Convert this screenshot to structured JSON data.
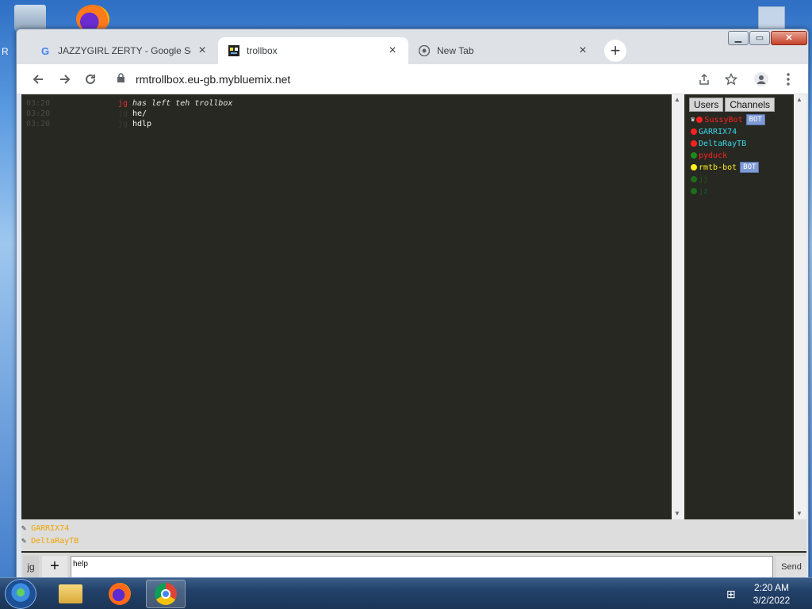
{
  "desktop": {
    "label_partial": "R"
  },
  "browser": {
    "tabs": [
      {
        "title": "JAZZYGIRL ZERTY - Google Search",
        "icon": "google-icon",
        "active": false
      },
      {
        "title": "trollbox",
        "icon": "trollbox-icon",
        "active": true
      },
      {
        "title": "New Tab",
        "icon": "chrome-icon",
        "active": false
      }
    ],
    "url": "rmtrollbox.eu-gb.mybluemix.net",
    "google_glyph": "G",
    "newtab_glyph": "+",
    "close_glyph": "×"
  },
  "chat": {
    "messages": [
      {
        "time": "03:20",
        "nick": "jg",
        "text": "has left teh trollbox",
        "system": true,
        "nick_color": "#e03030"
      },
      {
        "time": "03:20",
        "nick": "jg",
        "text": "he/",
        "system": false,
        "nick_color": "#3a3a34"
      },
      {
        "time": "03:20",
        "nick": "jg",
        "text": "hdlp",
        "system": false,
        "nick_color": "#3a3a34"
      }
    ]
  },
  "users_panel": {
    "tabs": [
      "Users",
      "Channels"
    ],
    "users": [
      {
        "name": "SussyBot",
        "dot_color": "#ff2020",
        "name_color": "#ff2020",
        "bot": true,
        "crown": true
      },
      {
        "name": "GARRIX74",
        "dot_color": "#ff2020",
        "name_color": "#3ad7e8",
        "bot": false
      },
      {
        "name": "DeltaRayTB",
        "dot_color": "#ff2020",
        "name_color": "#3ad7e8",
        "bot": false
      },
      {
        "name": "pyduck",
        "dot_color": "#1b8c1b",
        "name_color": "#ff2020",
        "bot": false
      },
      {
        "name": "rmtb-bot",
        "dot_color": "#ffee22",
        "name_color": "#ffee22",
        "bot": true
      },
      {
        "name": "jj",
        "dot_color": "#1b6e1b",
        "name_color": "#1d5a1d",
        "bot": false
      },
      {
        "name": "jz",
        "dot_color": "#1b6e1b",
        "name_color": "#1d5a1d",
        "bot": false
      }
    ],
    "bot_label": "BOT"
  },
  "typing": [
    "GARRIX74",
    "DeltaRayTB"
  ],
  "input_bar": {
    "nick": "jg",
    "plus": "+",
    "value": "help",
    "send": "Send"
  },
  "taskbar": {
    "time": "2:20 AM",
    "date": "3/2/2022"
  }
}
